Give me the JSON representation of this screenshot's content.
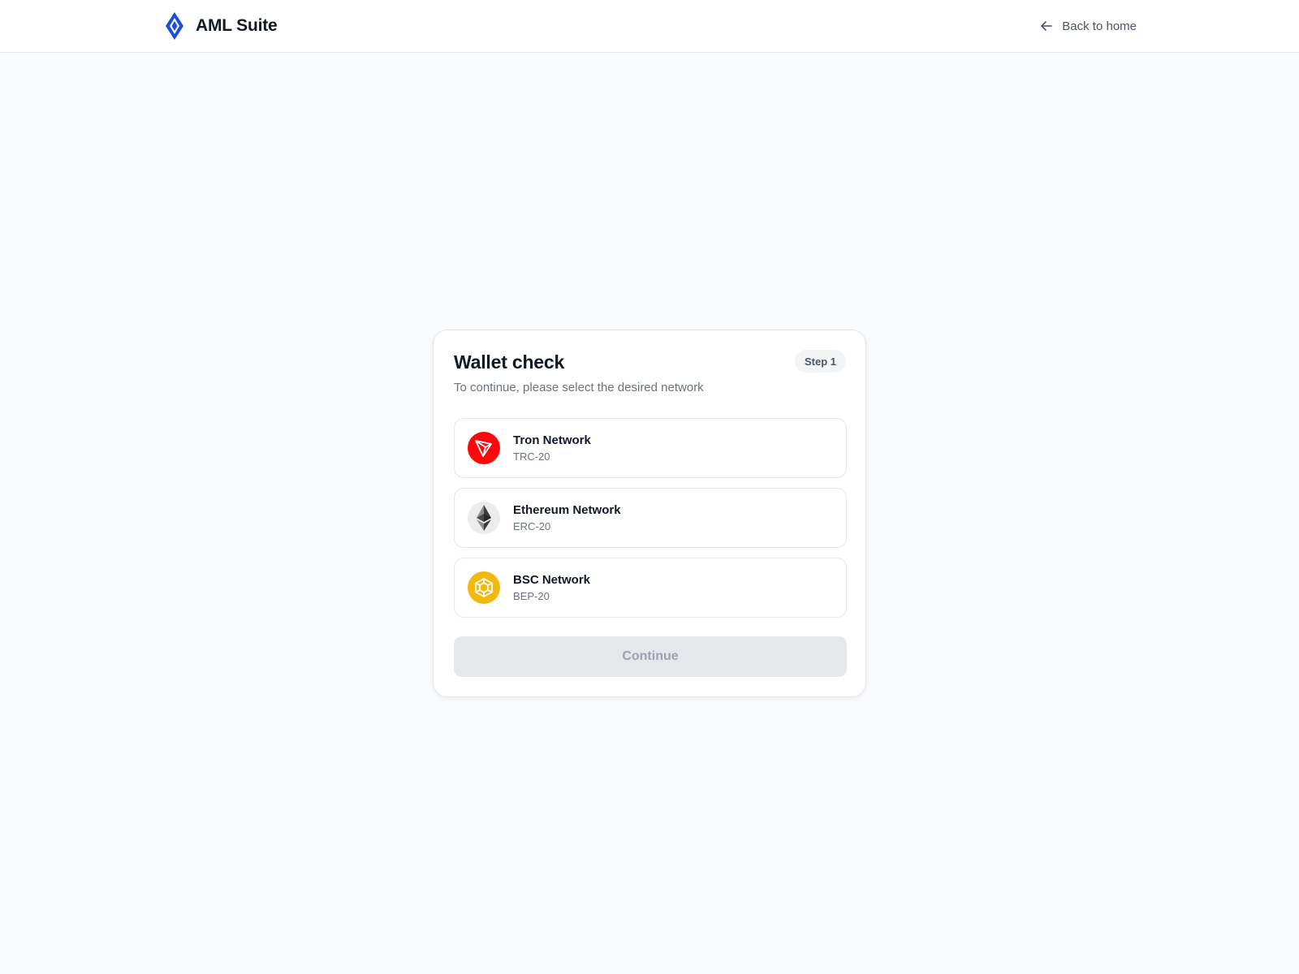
{
  "header": {
    "brand_name": "AML Suite",
    "brand_icon": "diamond-logo-icon",
    "back_label": "Back to home",
    "back_icon": "arrow-left-icon"
  },
  "card": {
    "title": "Wallet check",
    "step_badge": "Step 1",
    "subtitle": "To continue, please select the desired network",
    "networks": [
      {
        "name": "Tron Network",
        "standard": "TRC-20",
        "icon": "tron-icon",
        "color": "#ff060a"
      },
      {
        "name": "Ethereum Network",
        "standard": "ERC-20",
        "icon": "ethereum-icon",
        "color": "#ececec"
      },
      {
        "name": "BSC Network",
        "standard": "BEP-20",
        "icon": "bnb-icon",
        "color": "#f0b90b"
      }
    ],
    "continue_label": "Continue",
    "continue_enabled": false
  },
  "colors": {
    "accent": "#1d4ed8",
    "page_background": "#f9fafb",
    "button_disabled_bg": "#e5e7eb",
    "button_disabled_text": "#9ca3af"
  }
}
